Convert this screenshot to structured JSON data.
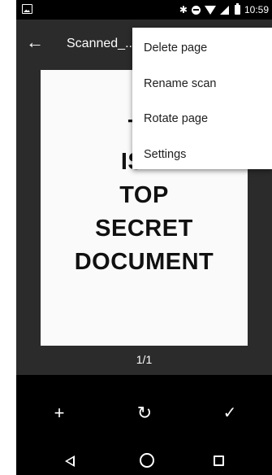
{
  "status_bar": {
    "time": "10:59",
    "icons": [
      "image-notification-icon",
      "bluetooth-icon",
      "do-not-disturb-icon",
      "wifi-icon",
      "cellular-signal-icon",
      "battery-icon"
    ]
  },
  "app_bar": {
    "title": "Scanned_..."
  },
  "document": {
    "lines": [
      "TH",
      "IS A",
      "TOP",
      "SECRET",
      "DOCUMENT"
    ]
  },
  "page_indicator": "1/1",
  "overflow_menu": {
    "items": [
      {
        "label": "Delete page"
      },
      {
        "label": "Rename scan"
      },
      {
        "label": "Rotate page"
      },
      {
        "label": "Settings"
      }
    ]
  },
  "actions": {
    "add_icon": "+",
    "rotate_icon": "↻",
    "done_icon": "✓"
  },
  "nav_bar": {
    "icons": [
      "back-icon",
      "home-icon",
      "recents-icon"
    ]
  }
}
